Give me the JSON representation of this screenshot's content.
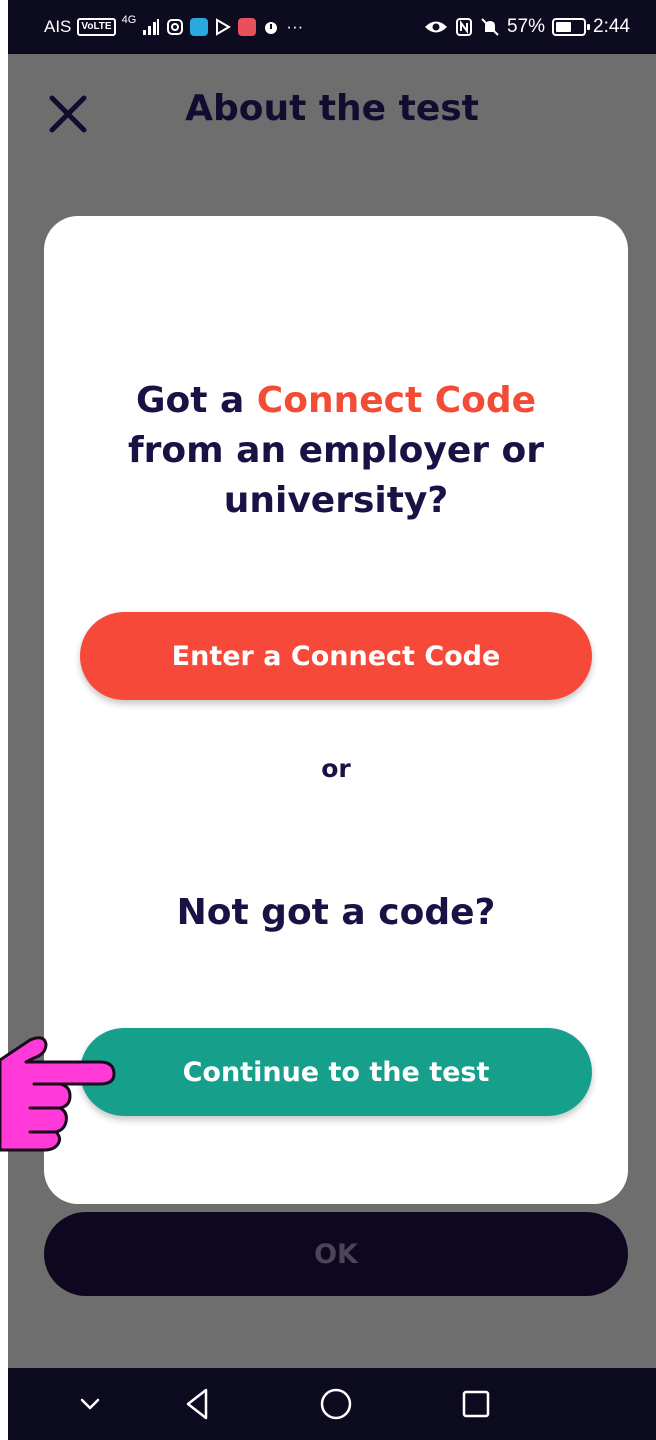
{
  "status_bar": {
    "carrier": "AIS",
    "volte": "VoLTE",
    "network": "4G",
    "battery_text": "57%",
    "battery_level": 0.57,
    "time": "2:44",
    "more": "···"
  },
  "header": {
    "title": "About the test"
  },
  "modal": {
    "heading_part1": "Got a ",
    "heading_highlight": "Connect Code",
    "heading_part2": "from an employer or university?",
    "enter_code_label": "Enter a Connect Code",
    "or_label": "or",
    "no_code_heading": "Not got a code?",
    "continue_label": "Continue to the test"
  },
  "background": {
    "ok_label": "OK"
  },
  "colors": {
    "accent": "#f24b36",
    "primary_button": "#f6493a",
    "secondary_button": "#16a08c",
    "heading_text": "#1a1145",
    "pointer_hand": "#ff3ad9"
  },
  "icons": {
    "close": "close-icon",
    "nav_down": "chevron-down-icon",
    "nav_back": "back-triangle-icon",
    "nav_home": "home-circle-icon",
    "nav_recents": "recents-square-icon",
    "pointer": "pointing-hand-icon"
  }
}
